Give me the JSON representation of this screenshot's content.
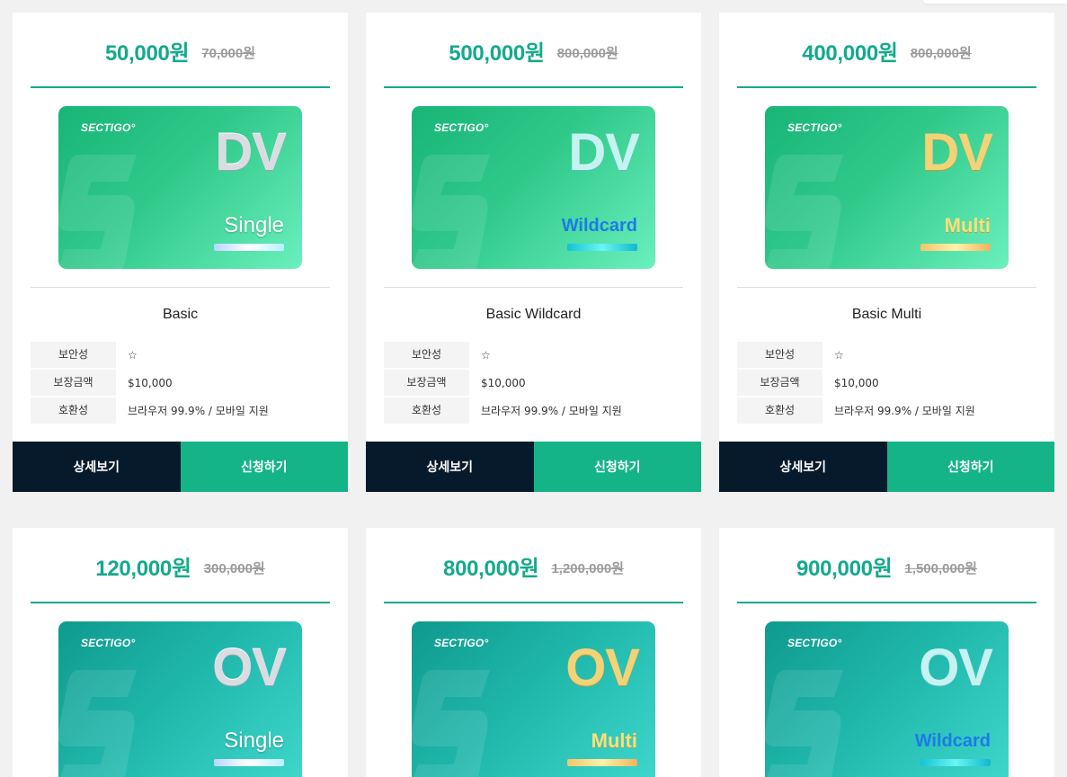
{
  "cards": [
    {
      "price": "50,000원",
      "orig": "70,000원",
      "brand": "SECTIGO°",
      "type": "DV",
      "sub": "Single",
      "name": "Basic",
      "specs": [
        {
          "k": "보안성",
          "v": "☆"
        },
        {
          "k": "보장금액",
          "v": "$10,000"
        },
        {
          "k": "호환성",
          "v": "브라우저 99.9% / 모바일 지원"
        }
      ],
      "detail_label": "상세보기",
      "apply_label": "신청하기"
    },
    {
      "price": "500,000원",
      "orig": "800,000원",
      "brand": "SECTIGO°",
      "type": "DV",
      "sub": "Wildcard",
      "name": "Basic Wildcard",
      "specs": [
        {
          "k": "보안성",
          "v": "☆"
        },
        {
          "k": "보장금액",
          "v": "$10,000"
        },
        {
          "k": "호환성",
          "v": "브라우저 99.9% / 모바일 지원"
        }
      ],
      "detail_label": "상세보기",
      "apply_label": "신청하기"
    },
    {
      "price": "400,000원",
      "orig": "800,000원",
      "brand": "SECTIGO°",
      "type": "DV",
      "sub": "Multi",
      "name": "Basic Multi",
      "specs": [
        {
          "k": "보안성",
          "v": "☆"
        },
        {
          "k": "보장금액",
          "v": "$10,000"
        },
        {
          "k": "호환성",
          "v": "브라우저 99.9% / 모바일 지원"
        }
      ],
      "detail_label": "상세보기",
      "apply_label": "신청하기"
    },
    {
      "price": "120,000원",
      "orig": "300,000원",
      "brand": "SECTIGO°",
      "type": "OV",
      "sub": "Single"
    },
    {
      "price": "800,000원",
      "orig": "1,200,000원",
      "brand": "SECTIGO°",
      "type": "OV",
      "sub": "Multi"
    },
    {
      "price": "900,000원",
      "orig": "1,500,000원",
      "brand": "SECTIGO°",
      "type": "OV",
      "sub": "Wildcard"
    }
  ],
  "colors": {
    "accent": "#14a98c",
    "apply": "#14b487",
    "detail": "#071a2b"
  }
}
